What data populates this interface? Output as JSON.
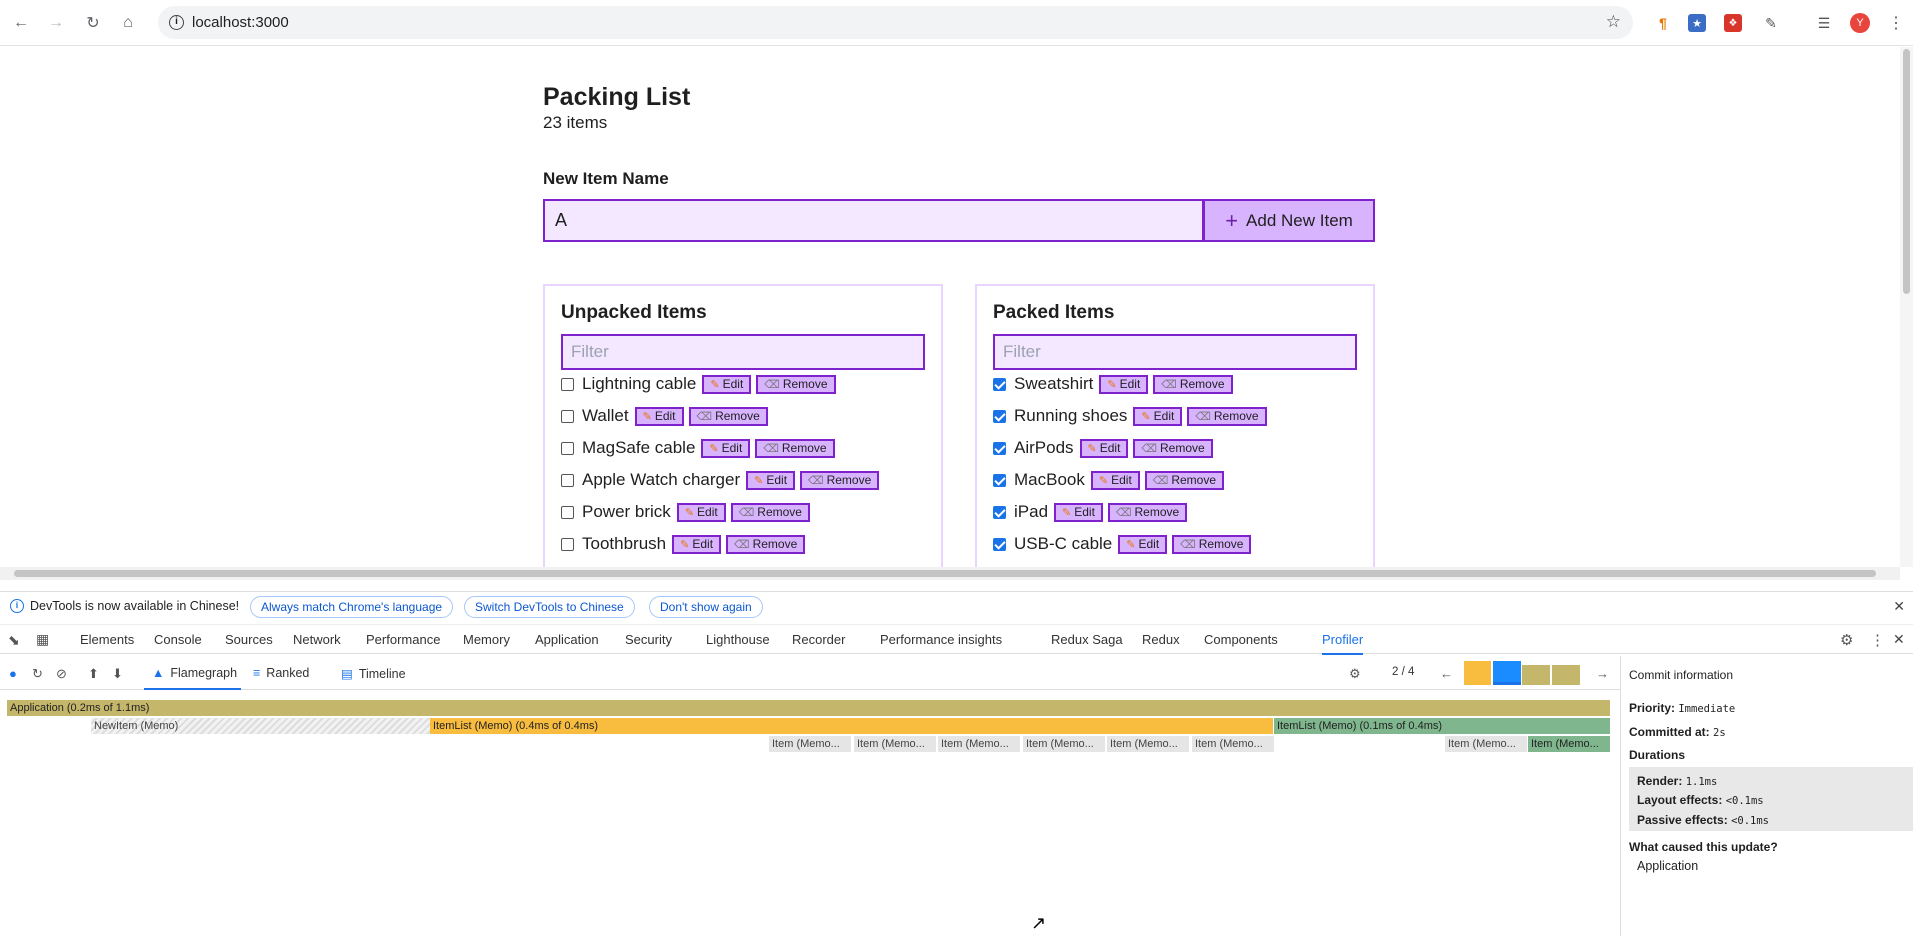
{
  "browser": {
    "url": "localhost:3000",
    "profile_initial": "Y"
  },
  "app": {
    "title": "Packing List",
    "count": "23 items",
    "new_item_label": "New Item Name",
    "new_item_value": "A",
    "add_button": "Add New Item",
    "unpacked": {
      "title": "Unpacked Items",
      "filter_placeholder": "Filter",
      "items": [
        "Lightning cable",
        "Wallet",
        "MagSafe cable",
        "Apple Watch charger",
        "Power brick",
        "Toothbrush"
      ]
    },
    "packed": {
      "title": "Packed Items",
      "filter_placeholder": "Filter",
      "items": [
        "Sweatshirt",
        "Running shoes",
        "AirPods",
        "MacBook",
        "iPad",
        "USB-C cable"
      ]
    },
    "edit_label": "Edit",
    "remove_label": "Remove"
  },
  "devtools": {
    "notice": "DevTools is now available in Chinese!",
    "pill_match": "Always match Chrome's language",
    "pill_switch": "Switch DevTools to Chinese",
    "pill_dont": "Don't show again",
    "tabs": [
      "Elements",
      "Console",
      "Sources",
      "Network",
      "Performance",
      "Memory",
      "Application",
      "Security",
      "Lighthouse",
      "Recorder",
      "Performance insights",
      "Redux Saga",
      "Redux",
      "Components",
      "Profiler"
    ],
    "profiler": {
      "flamegraph": "Flamegraph",
      "ranked": "Ranked",
      "timeline": "Timeline",
      "commit_index": "2 / 4",
      "bars": {
        "application": "Application (0.2ms of 1.1ms)",
        "newitem": "NewItem (Memo)",
        "itemlist1": "ItemList (Memo) (0.4ms of 0.4ms)",
        "itemlist2": "ItemList (Memo) (0.1ms of 0.4ms)",
        "item": "Item (Memo..."
      }
    },
    "commit_info": {
      "header": "Commit information",
      "priority_label": "Priority",
      "priority_value": "Immediate",
      "committed_label": "Committed at",
      "committed_value": "2s",
      "durations_label": "Durations",
      "render_label": "Render",
      "render_value": "1.1ms",
      "layout_label": "Layout effects",
      "layout_value": "<0.1ms",
      "passive_label": "Passive effects",
      "passive_value": "<0.1ms",
      "cause_label": "What caused this update?",
      "cause_value": "Application"
    }
  }
}
